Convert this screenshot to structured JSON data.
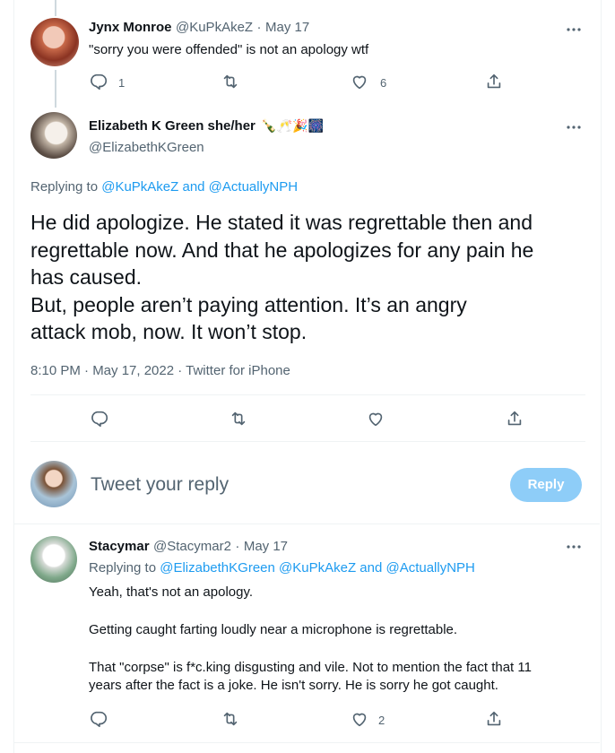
{
  "tweet1": {
    "name": "Jynx Monroe",
    "handle": "@KuPkAkeZ",
    "dot": "·",
    "date": "May 17",
    "text": "\"sorry you were offended\" is  not an apology wtf",
    "reply_count": "1",
    "like_count": "6"
  },
  "main": {
    "name": "Elizabeth K Green she/her",
    "emojis": "🍾🥂🎉🎆",
    "handle": "@ElizabethKGreen",
    "replying_prefix": "Replying to",
    "replying_users": "@KuPkAkeZ and @ActuallyNPH",
    "text_lines": [
      "He did apologize. He stated it was regrettable then and",
      "regrettable now. And that he apologizes for any pain he",
      "has caused.",
      "But, people aren’t paying attention. It’s an angry",
      "attack mob, now. It won’t stop."
    ],
    "meta": "8:10 PM · May 17, 2022 · Twitter for iPhone"
  },
  "compose": {
    "placeholder": "Tweet your reply",
    "reply_button": "Reply"
  },
  "tweet3": {
    "name": "Stacymar",
    "handle": "@Stacymar2",
    "dot": "·",
    "date": "May 17",
    "replying_prefix": "Replying to",
    "replying_users": "@ElizabethKGreen @KuPkAkeZ and @ActuallyNPH",
    "paragraphs": [
      "Yeah, that's not an apology.",
      "Getting caught farting loudly near a microphone is regrettable.",
      "That \"corpse\" is f*c.king disgusting and vile. Not to mention the fact that 11",
      "years after the fact is a joke. He isn't sorry. He is sorry he got caught."
    ],
    "like_count": "2"
  },
  "colors": {
    "accent": "#1d9bf0",
    "muted": "#536471",
    "reply_button_bg": "#8ecdf8"
  },
  "icons": [
    "reply-icon",
    "retweet-icon",
    "like-icon",
    "share-icon",
    "more-icon"
  ]
}
